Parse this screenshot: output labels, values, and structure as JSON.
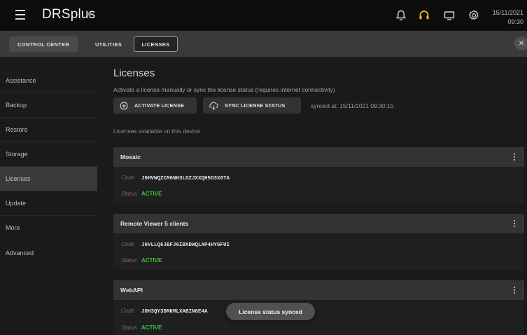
{
  "header": {
    "title": "DRSplus",
    "date": "15/11/2021",
    "time": "09:30",
    "accent": "#f2c200"
  },
  "tabs": [
    {
      "label": "CONTROL CENTER"
    },
    {
      "label": "UTILITIES"
    },
    {
      "label": "LICENSES"
    }
  ],
  "sidebar": {
    "items": [
      {
        "label": "Assistance"
      },
      {
        "label": "Backup"
      },
      {
        "label": "Restore"
      },
      {
        "label": "Storage"
      },
      {
        "label": "Licenses",
        "active": true
      },
      {
        "label": "Update"
      },
      {
        "label": "More"
      },
      {
        "label": "Advanced"
      }
    ]
  },
  "main": {
    "title": "Licenses",
    "subtitle": "Activate a license manually or sync the license status (requires internet connectivity)",
    "activate_label": "ACTIVATE LICENSE",
    "sync_label": "SYNC LICENSE STATUS",
    "synced_text": "synced at: 15/11/2021 09:30:15",
    "available_label": "Licenses available on this device",
    "code_label": "Code",
    "status_label": "Status",
    "licenses": [
      {
        "name": "Mosaic",
        "code": "J0HVWQZCM6NH3LOZJXXQH5O3X6TA",
        "status": "ACTIVE"
      },
      {
        "name": "Remote Viewer 5 clients",
        "code": "J0VLLQ6JBFJ6IBXDWQLAP4HYGFUI",
        "status": "ACTIVE"
      },
      {
        "name": "WebAPI",
        "code": "J0H3QY3DMKMLXABIN6E4A",
        "status": "ACTIVE"
      }
    ],
    "status_color": "#39c23a"
  },
  "toast": {
    "text": "License status synced"
  }
}
